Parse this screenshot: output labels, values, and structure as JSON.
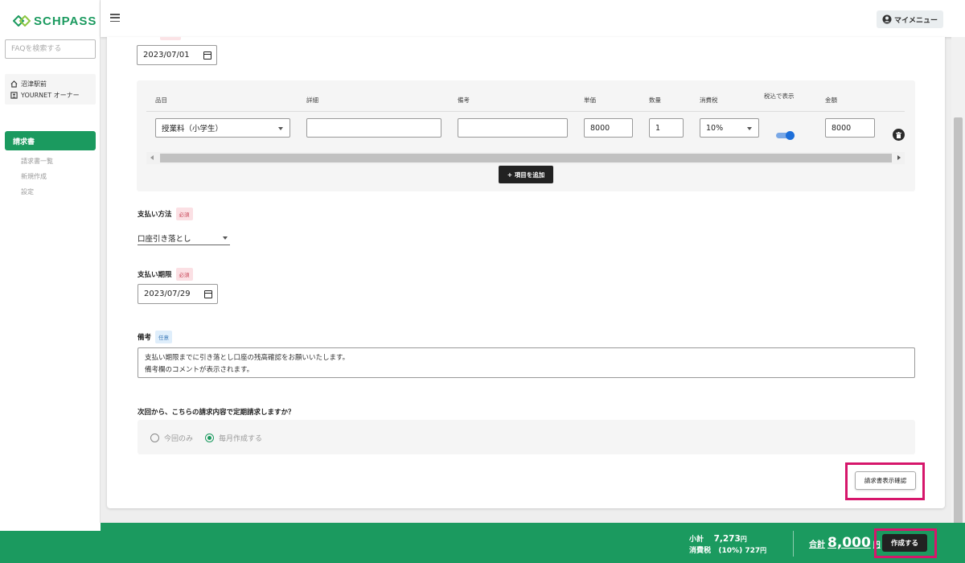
{
  "app": {
    "logo_text": "SCHPASS"
  },
  "sidebar": {
    "faq_placeholder": "FAQを検索する",
    "school_name": "沼津駅前",
    "account_name": "YOURNET オーナー",
    "nav_main": "請求書",
    "nav_items": [
      "請求書一覧",
      "新規作成",
      "設定"
    ]
  },
  "header": {
    "my_menu": "マイメニュー"
  },
  "form": {
    "issue_date": "2023/07/01",
    "items_table": {
      "headers": [
        "品目",
        "詳細",
        "備考",
        "単価",
        "数量",
        "消費税",
        "税込で表示",
        "金額"
      ],
      "row": {
        "item": "授業料（小学生）",
        "detail": "",
        "note": "",
        "unit_price": "8000",
        "quantity": "1",
        "tax": "10%",
        "tax_included": true,
        "amount": "8000"
      }
    },
    "add_item_label": "+ 項目を追加",
    "payment_method": {
      "label": "支払い方法",
      "badge": "必須",
      "value": "口座引き落とし"
    },
    "payment_due": {
      "label": "支払い期限",
      "badge": "必須",
      "value": "2023/07/29"
    },
    "remarks": {
      "label": "備考",
      "badge": "任意",
      "line1": "支払い期限までに引き落とし口座の残高確認をお願いいたします。",
      "line2": "備考欄のコメントが表示されます。"
    },
    "recurring_question": "次回から、こちらの請求内容で定期請求しますか？",
    "recurring_options": [
      "今回のみ",
      "毎月作成する"
    ],
    "recurring_selected": "毎月作成する",
    "preview_button": "請求書表示確認"
  },
  "footer": {
    "subtotal_label": "小計",
    "subtotal_value": "7,273",
    "tax_label": "消費税",
    "tax_rate": "(10%)",
    "tax_value": "727",
    "yen": "円",
    "total_label": "合計",
    "total_value": "8,000",
    "create_button": "作成する"
  },
  "colors": {
    "brand_green": "#1b9a5f",
    "highlight": "#d6166b",
    "toggle_blue": "#1e6fd9"
  }
}
